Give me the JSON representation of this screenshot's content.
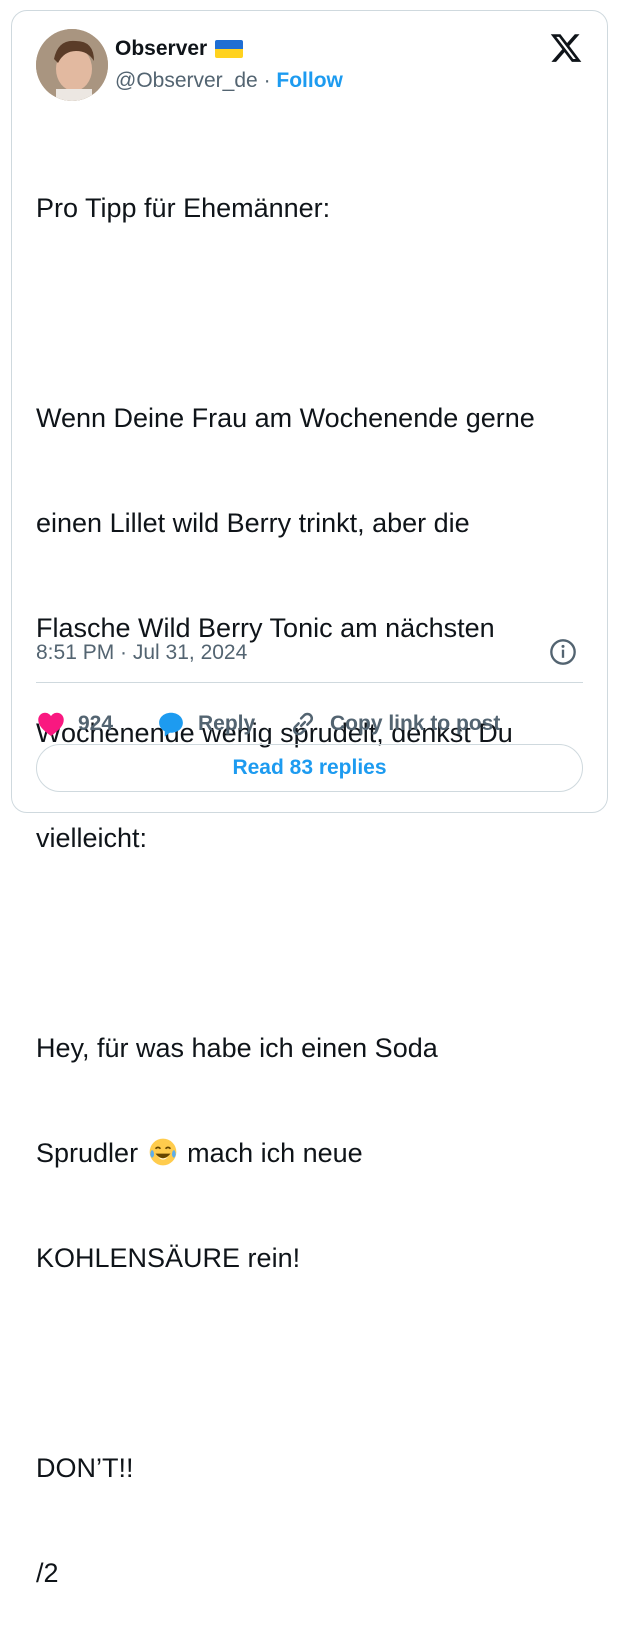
{
  "author": {
    "name": "Observer",
    "handle": "@Observer_de",
    "separator": "·",
    "follow_label": "Follow",
    "flag_icon": "ukraine-flag-icon"
  },
  "tweet": {
    "lines": [
      "Pro Tipp für Ehemänner:",
      "",
      "Wenn Deine Frau am Wochenende gerne",
      "einen Lillet wild Berry trinkt, aber die",
      "Flasche Wild Berry Tonic am nächsten",
      "Wochenende wenig sprudelt, denkst Du",
      "vielleicht:",
      "",
      "Hey, für was habe ich einen Soda",
      "Sprudler",
      "mach ich neue",
      "KOHLENSÄURE rein!",
      "",
      "DON’T!!",
      "/2"
    ],
    "emoji_icon": "tears-of-joy-emoji-icon",
    "timestamp": "8:51 PM · Jul 31, 2024"
  },
  "actions": {
    "like_count": "924",
    "reply_label": "Reply",
    "copy_label": "Copy link to post"
  },
  "read_replies_label": "Read 83 replies",
  "colors": {
    "accent": "#1d9bf0",
    "like": "#f91880",
    "text": "#0f1419",
    "muted": "#536471",
    "border": "#cfd9de"
  }
}
